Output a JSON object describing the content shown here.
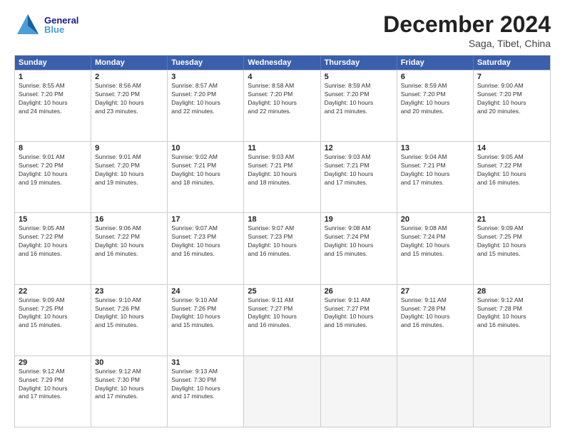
{
  "logo": {
    "general": "General",
    "blue": "Blue"
  },
  "header": {
    "month": "December 2024",
    "location": "Saga, Tibet, China"
  },
  "weekdays": [
    "Sunday",
    "Monday",
    "Tuesday",
    "Wednesday",
    "Thursday",
    "Friday",
    "Saturday"
  ],
  "rows": [
    [
      {
        "day": "1",
        "info": "Sunrise: 8:55 AM\nSunset: 7:20 PM\nDaylight: 10 hours\nand 24 minutes."
      },
      {
        "day": "2",
        "info": "Sunrise: 8:56 AM\nSunset: 7:20 PM\nDaylight: 10 hours\nand 23 minutes."
      },
      {
        "day": "3",
        "info": "Sunrise: 8:57 AM\nSunset: 7:20 PM\nDaylight: 10 hours\nand 22 minutes."
      },
      {
        "day": "4",
        "info": "Sunrise: 8:58 AM\nSunset: 7:20 PM\nDaylight: 10 hours\nand 22 minutes."
      },
      {
        "day": "5",
        "info": "Sunrise: 8:59 AM\nSunset: 7:20 PM\nDaylight: 10 hours\nand 21 minutes."
      },
      {
        "day": "6",
        "info": "Sunrise: 8:59 AM\nSunset: 7:20 PM\nDaylight: 10 hours\nand 20 minutes."
      },
      {
        "day": "7",
        "info": "Sunrise: 9:00 AM\nSunset: 7:20 PM\nDaylight: 10 hours\nand 20 minutes."
      }
    ],
    [
      {
        "day": "8",
        "info": "Sunrise: 9:01 AM\nSunset: 7:20 PM\nDaylight: 10 hours\nand 19 minutes."
      },
      {
        "day": "9",
        "info": "Sunrise: 9:01 AM\nSunset: 7:20 PM\nDaylight: 10 hours\nand 19 minutes."
      },
      {
        "day": "10",
        "info": "Sunrise: 9:02 AM\nSunset: 7:21 PM\nDaylight: 10 hours\nand 18 minutes."
      },
      {
        "day": "11",
        "info": "Sunrise: 9:03 AM\nSunset: 7:21 PM\nDaylight: 10 hours\nand 18 minutes."
      },
      {
        "day": "12",
        "info": "Sunrise: 9:03 AM\nSunset: 7:21 PM\nDaylight: 10 hours\nand 17 minutes."
      },
      {
        "day": "13",
        "info": "Sunrise: 9:04 AM\nSunset: 7:21 PM\nDaylight: 10 hours\nand 17 minutes."
      },
      {
        "day": "14",
        "info": "Sunrise: 9:05 AM\nSunset: 7:22 PM\nDaylight: 10 hours\nand 16 minutes."
      }
    ],
    [
      {
        "day": "15",
        "info": "Sunrise: 9:05 AM\nSunset: 7:22 PM\nDaylight: 10 hours\nand 16 minutes."
      },
      {
        "day": "16",
        "info": "Sunrise: 9:06 AM\nSunset: 7:22 PM\nDaylight: 10 hours\nand 16 minutes."
      },
      {
        "day": "17",
        "info": "Sunrise: 9:07 AM\nSunset: 7:23 PM\nDaylight: 10 hours\nand 16 minutes."
      },
      {
        "day": "18",
        "info": "Sunrise: 9:07 AM\nSunset: 7:23 PM\nDaylight: 10 hours\nand 16 minutes."
      },
      {
        "day": "19",
        "info": "Sunrise: 9:08 AM\nSunset: 7:24 PM\nDaylight: 10 hours\nand 15 minutes."
      },
      {
        "day": "20",
        "info": "Sunrise: 9:08 AM\nSunset: 7:24 PM\nDaylight: 10 hours\nand 15 minutes."
      },
      {
        "day": "21",
        "info": "Sunrise: 9:09 AM\nSunset: 7:25 PM\nDaylight: 10 hours\nand 15 minutes."
      }
    ],
    [
      {
        "day": "22",
        "info": "Sunrise: 9:09 AM\nSunset: 7:25 PM\nDaylight: 10 hours\nand 15 minutes."
      },
      {
        "day": "23",
        "info": "Sunrise: 9:10 AM\nSunset: 7:26 PM\nDaylight: 10 hours\nand 15 minutes."
      },
      {
        "day": "24",
        "info": "Sunrise: 9:10 AM\nSunset: 7:26 PM\nDaylight: 10 hours\nand 15 minutes."
      },
      {
        "day": "25",
        "info": "Sunrise: 9:11 AM\nSunset: 7:27 PM\nDaylight: 10 hours\nand 16 minutes."
      },
      {
        "day": "26",
        "info": "Sunrise: 9:11 AM\nSunset: 7:27 PM\nDaylight: 10 hours\nand 16 minutes."
      },
      {
        "day": "27",
        "info": "Sunrise: 9:11 AM\nSunset: 7:28 PM\nDaylight: 10 hours\nand 16 minutes."
      },
      {
        "day": "28",
        "info": "Sunrise: 9:12 AM\nSunset: 7:28 PM\nDaylight: 10 hours\nand 16 minutes."
      }
    ],
    [
      {
        "day": "29",
        "info": "Sunrise: 9:12 AM\nSunset: 7:29 PM\nDaylight: 10 hours\nand 17 minutes."
      },
      {
        "day": "30",
        "info": "Sunrise: 9:12 AM\nSunset: 7:30 PM\nDaylight: 10 hours\nand 17 minutes."
      },
      {
        "day": "31",
        "info": "Sunrise: 9:13 AM\nSunset: 7:30 PM\nDaylight: 10 hours\nand 17 minutes."
      },
      {
        "day": "",
        "info": ""
      },
      {
        "day": "",
        "info": ""
      },
      {
        "day": "",
        "info": ""
      },
      {
        "day": "",
        "info": ""
      }
    ]
  ]
}
